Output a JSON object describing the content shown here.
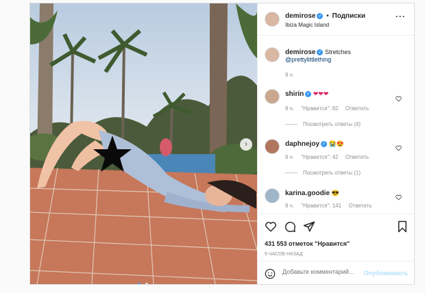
{
  "header": {
    "username": "demirose",
    "separator": "•",
    "follow_label": "Подписки",
    "location": "Ibiza Magic Island"
  },
  "caption": {
    "username": "demirose",
    "text": "Stretches",
    "mention": "@prettylittlething",
    "time": "9 ч."
  },
  "comments": [
    {
      "username": "shirin",
      "text": "❤❤❤",
      "time": "9 ч.",
      "likes": "\"Нравится\": 82",
      "reply": "Ответить",
      "view_replies": "Посмотреть ответы (4)"
    },
    {
      "username": "daphnejoy",
      "text": "😭😍",
      "time": "6 ч.",
      "likes": "\"Нравится\": 42",
      "reply": "Ответить",
      "view_replies": "Посмотреть ответы (1)"
    },
    {
      "username": "karina.goodie",
      "text": "😎",
      "time": "9 ч.",
      "likes": "\"Нравится\": 141",
      "reply": "Ответить"
    }
  ],
  "likes_count": "431 553 отметок \"Нравится\"",
  "post_time": "9 часов назад",
  "add_comment": {
    "placeholder": "Добавьте комментарий...",
    "publish_label": "Опубликовать"
  },
  "carousel": {
    "slides": 2,
    "active": 1
  },
  "colors": {
    "accent": "#3897f0",
    "publish": "#b2dffc",
    "muted": "#8e8e8e",
    "heart": "#e0245e"
  }
}
